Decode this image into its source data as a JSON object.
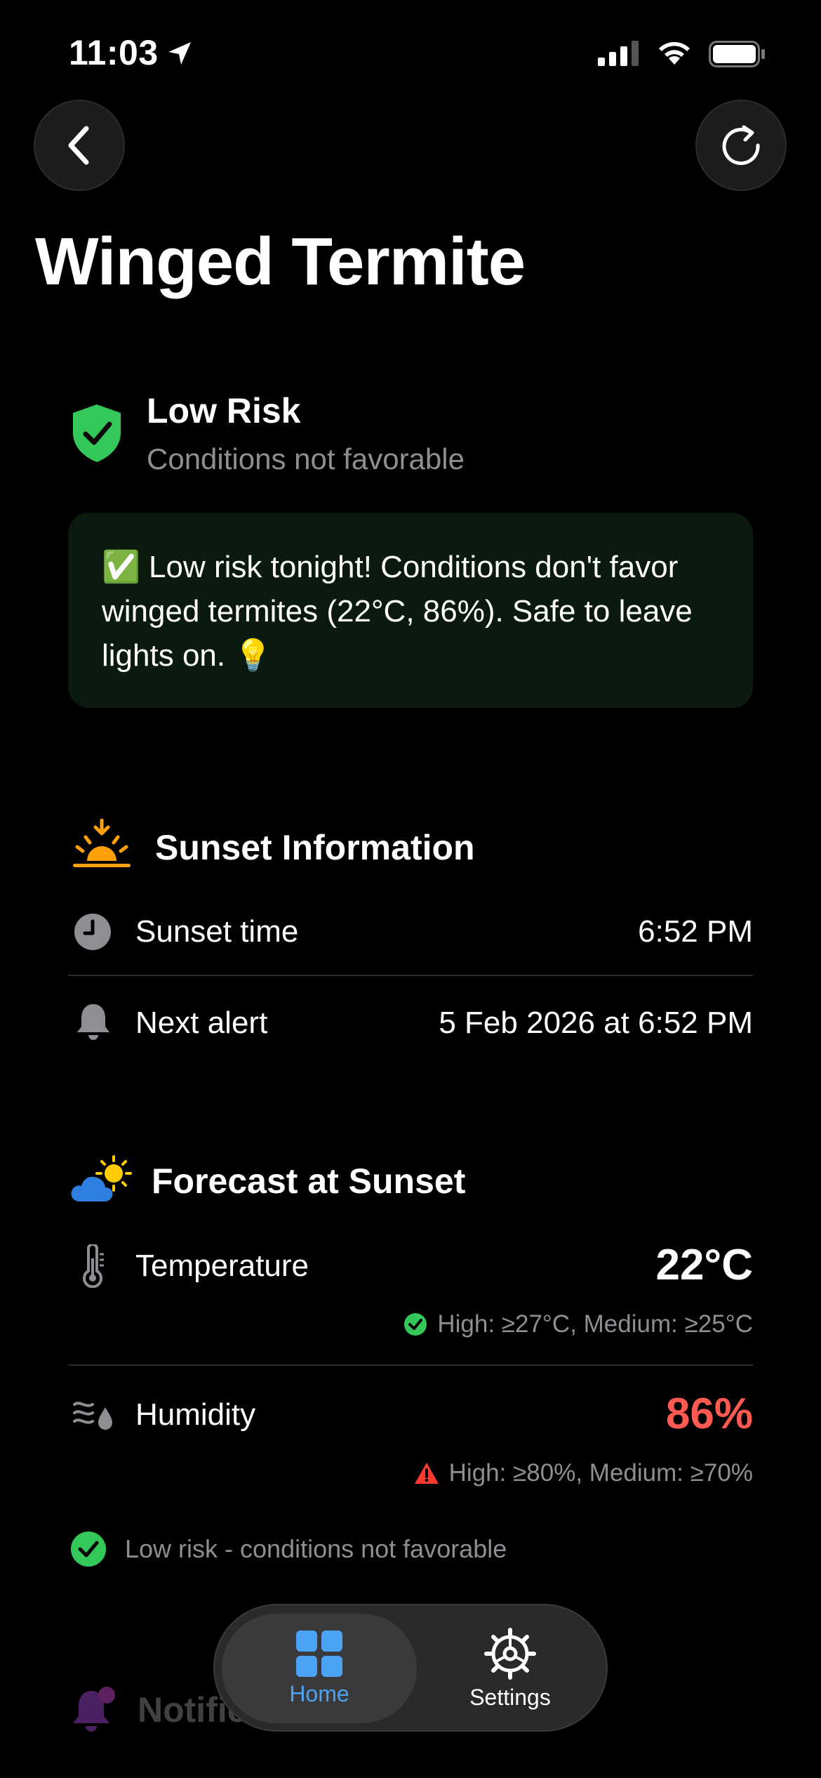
{
  "status_bar": {
    "time": "11:03"
  },
  "header": {
    "title": "Winged Termite"
  },
  "risk": {
    "level": "Low Risk",
    "subtitle": "Conditions not favorable",
    "message": "✅ Low risk tonight! Conditions don't favor winged termites (22°C, 86%). Safe to leave lights on. 💡"
  },
  "sunset_section": {
    "title": "Sunset Information",
    "rows": [
      {
        "label": "Sunset time",
        "value": "6:52 PM"
      },
      {
        "label": "Next alert",
        "value": "5 Feb 2026 at 6:52 PM"
      }
    ]
  },
  "forecast_section": {
    "title": "Forecast at Sunset",
    "temperature": {
      "label": "Temperature",
      "value": "22°C",
      "threshold": "High: ≥27°C, Medium: ≥25°C"
    },
    "humidity": {
      "label": "Humidity",
      "value": "86%",
      "threshold": "High: ≥80%, Medium: ≥70%"
    },
    "summary": "Low risk - conditions not favorable"
  },
  "notifications_peek": {
    "label": "Notific"
  },
  "tab_bar": {
    "tabs": [
      {
        "label": "Home",
        "icon": "grid-icon",
        "active": true
      },
      {
        "label": "Settings",
        "icon": "gear-icon",
        "active": false
      }
    ]
  },
  "colors": {
    "accent_blue": "#4ca3f5",
    "safe_green": "#34c759",
    "danger_red": "#ff5a52",
    "secondary_text": "#8e8e93"
  }
}
